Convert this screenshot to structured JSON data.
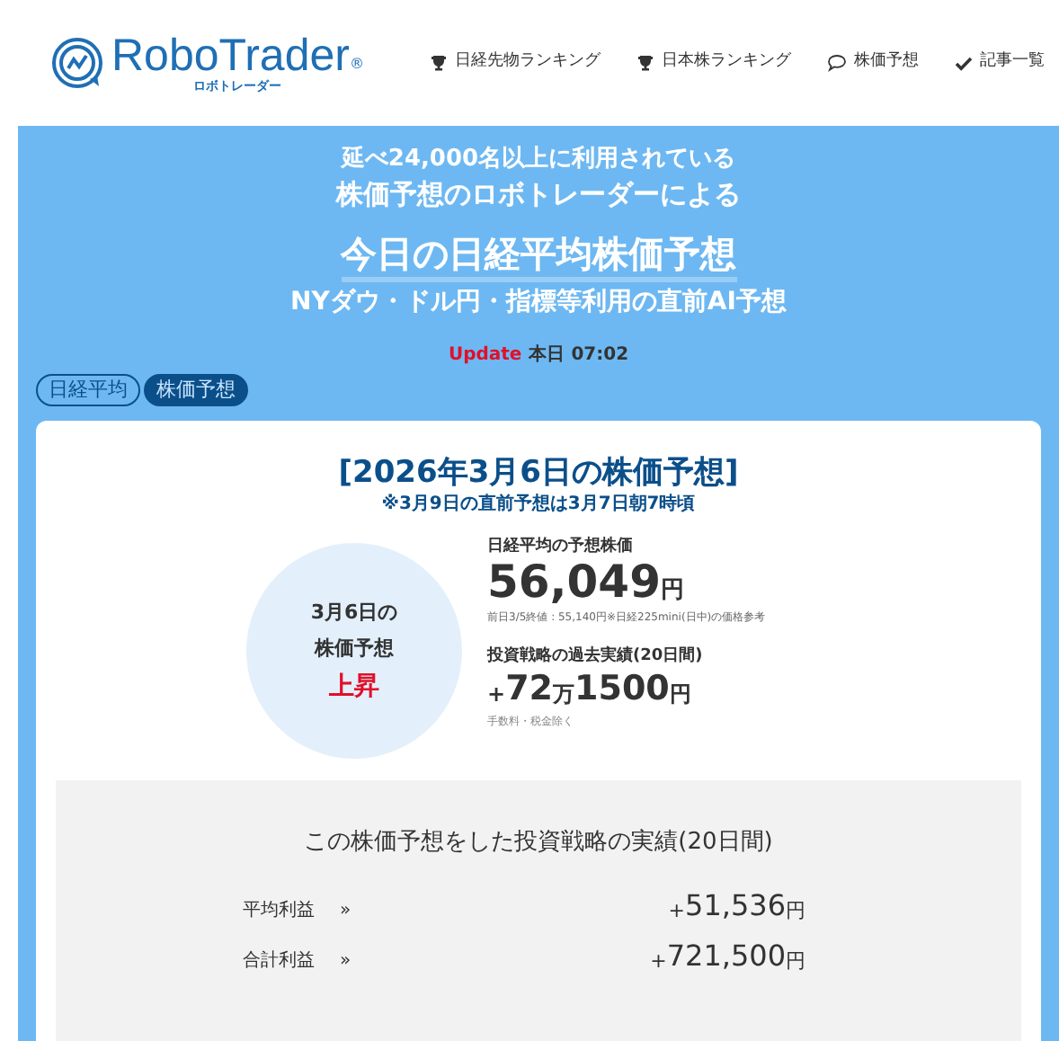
{
  "logo": {
    "name": "RoboTrader",
    "reg": "®",
    "kana": "ロボトレーダー"
  },
  "nav": [
    {
      "label": "日経先物ランキング",
      "kind": "trophy"
    },
    {
      "label": "日本株ランキング",
      "kind": "trophy"
    },
    {
      "label": "株価予想",
      "kind": "chat"
    },
    {
      "label": "記事一覧",
      "kind": "check"
    }
  ],
  "hero": {
    "line1": "延べ24,000名以上に利用されている",
    "line2": "株価予想のロボトレーダーによる",
    "title": "今日の日経平均株価予想",
    "subtitle": "NYダウ・ドル円・指標等利用の直前AI予想",
    "update_label": "Update",
    "update_time": "本日 07:02"
  },
  "tags": [
    {
      "label": "日経平均",
      "selected": false
    },
    {
      "label": "株価予想",
      "selected": true
    }
  ],
  "forecast": {
    "heading": "[2026年3月6日の株価予想]",
    "note": "※3月9日の直前予想は3月7日朝7時頃",
    "circle": {
      "date": "3月6日の",
      "label": "株価予想",
      "direction": "上昇"
    },
    "price_label": "日経平均の予想株価",
    "price": "56,049",
    "price_unit": "円",
    "price_note": "前日3/5終値 : 55,140円※日経225mini(日中)の価格参考",
    "perf_label": "投資戦略の過去実績(20日間)",
    "perf_sign": "+",
    "perf_parts": [
      {
        "text": "72",
        "big": true
      },
      {
        "text": "万",
        "big": false
      },
      {
        "text": "1500",
        "big": true
      },
      {
        "text": "円",
        "big": false
      }
    ],
    "perf_note": "手数料・税金除く"
  },
  "results": {
    "title": "この株価予想をした投資戦略の実績(20日間)",
    "rows": [
      {
        "label": "平均利益",
        "arrow": "»",
        "sign": "+",
        "amount": "51,536",
        "unit": "円"
      },
      {
        "label": "合計利益",
        "arrow": "»",
        "sign": "+",
        "amount": "721,500",
        "unit": "円"
      }
    ]
  }
}
